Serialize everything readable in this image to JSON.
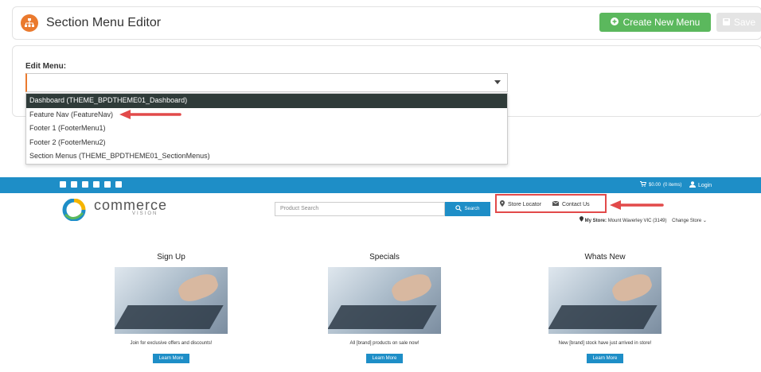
{
  "editor": {
    "title": "Section Menu Editor",
    "create_label": "Create New Menu",
    "save_label": "Save"
  },
  "edit_menu": {
    "label": "Edit Menu:",
    "selected": "",
    "options": [
      "Dashboard (THEME_BPDTHEME01_Dashboard)",
      "Feature Nav (FeatureNav)",
      "Footer 1 (FooterMenu1)",
      "Footer 2 (FooterMenu2)",
      "Section Menus (THEME_BPDTHEME01_SectionMenus)"
    ]
  },
  "store": {
    "cart": "$0.00",
    "cart_items": "(0 items)",
    "login": "Login",
    "brand": "commerce",
    "brand_sub": "VISION",
    "search_placeholder": "Product Search",
    "search_button": "Search",
    "store_locator": "Store Locator",
    "contact_us": "Contact Us",
    "my_store_label": "My Store:",
    "my_store_value": "Mount Waverley VIC (3149)",
    "change_store": "Change Store",
    "promos": [
      {
        "title": "Sign Up",
        "text": "Join for exclusive offers and discounts!",
        "button": "Learn More"
      },
      {
        "title": "Specials",
        "text": "All [brand] products on sale now!",
        "button": "Learn More"
      },
      {
        "title": "Whats New",
        "text": "New [brand] stock have just arrived in store!",
        "button": "Learn More"
      }
    ]
  },
  "colors": {
    "accent_orange": "#ea7a2e",
    "create_green": "#5bb85d",
    "store_blue": "#1e8ec7",
    "annotation_red": "#e24a4a"
  }
}
